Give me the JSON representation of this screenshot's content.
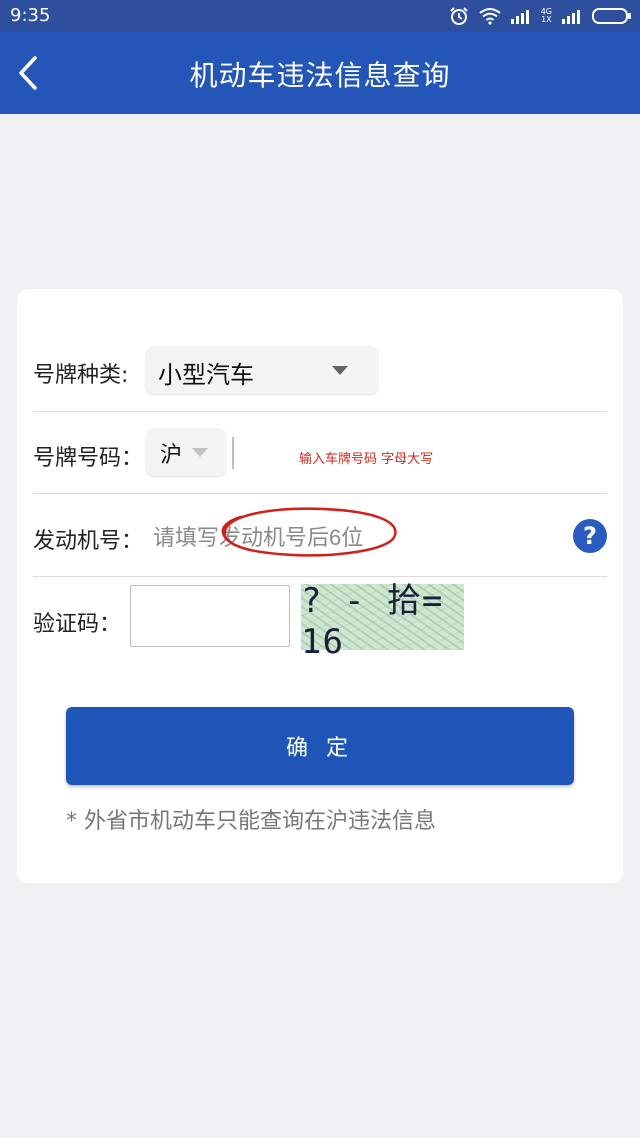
{
  "status_bar": {
    "time": "9:35",
    "network_label_top": "4G",
    "network_label_bottom": "1X"
  },
  "header": {
    "title": "机动车违法信息查询"
  },
  "form": {
    "plate_type": {
      "label": "号牌种类:",
      "selected": "小型汽车"
    },
    "plate_number": {
      "label": "号牌号码：",
      "province_selected": "沪",
      "hint": "输入车牌号码 字母大写"
    },
    "engine_number": {
      "label": "发动机号：",
      "placeholder": "请填写发动机号后6位"
    },
    "captcha": {
      "label": "验证码：",
      "image_text": "? - 拾= 16"
    },
    "submit_label": "确 定",
    "footnote": "* 外省市机动车只能查询在沪违法信息"
  },
  "colors": {
    "status_bar": "#2d4f9e",
    "header": "#2456b8",
    "button": "#1f55b6",
    "hint": "#d0261c",
    "background": "#efeff4"
  }
}
